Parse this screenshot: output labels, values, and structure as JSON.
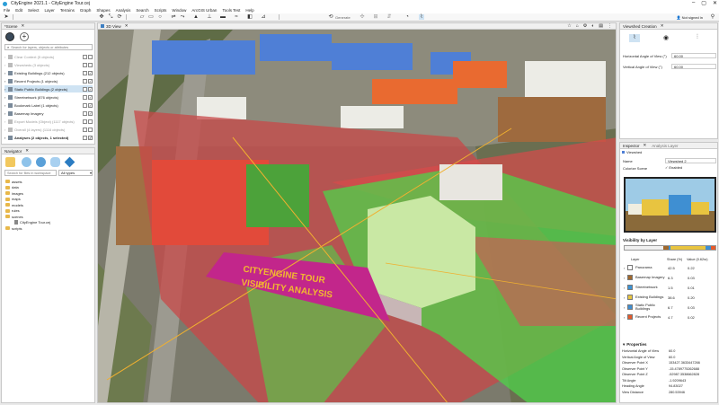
{
  "app": {
    "title": "CityEngine 2021.1 - CityEngine Tour.cej",
    "signin": "Not signed in"
  },
  "menu": [
    "File",
    "Edit",
    "Select",
    "Layer",
    "Terrains",
    "Graph",
    "Shapes",
    "Analysis",
    "Search",
    "Scripts",
    "Window",
    "ArcGIS Urban",
    "Tools Test",
    "Help"
  ],
  "toolbar": {
    "generate": "Generate"
  },
  "scene": {
    "tab": "*Scene",
    "search_placeholder": "Search for layers, objects or attributes",
    "layers": [
      {
        "name": "Clear Context (5 objects)",
        "faded": true
      },
      {
        "name": "Viewsheds (3 objects)",
        "faded": true
      },
      {
        "name": "Existing Buildings (212 objects)",
        "faded": false
      },
      {
        "name": "Recent Projects (1 objects)",
        "faded": false
      },
      {
        "name": "Static Public Buildings (2 objects)",
        "faded": false,
        "selected": true
      },
      {
        "name": "Streetnetwork (876 objects)",
        "faded": false
      },
      {
        "name": "Bookmark Label (1 objects)",
        "faded": false
      },
      {
        "name": "Basemap Imagery",
        "faded": false
      },
      {
        "name": "Export Models (Object) (1117 objects)",
        "faded": true
      },
      {
        "name": "Overall (4 layers) (1116 objects)",
        "faded": true
      },
      {
        "name": "Analyses (2 objects, 1 selected)",
        "faded": false,
        "bold": true
      }
    ]
  },
  "navigator": {
    "tab": "Navigator",
    "search_placeholder": "Search for files in workspace",
    "filter": "All types",
    "tree": [
      "assets",
      "data",
      "images",
      "maps",
      "models",
      "rules",
      "scenes",
      "CityEngine Tour.cej",
      "scripts"
    ]
  },
  "view3d": {
    "tab": "3D View",
    "banner_line1": "CITYENGINE TOUR",
    "banner_line2": "VISIBILITY ANALYSIS"
  },
  "viewshed": {
    "tab": "Viewshed Creation",
    "h_label": "Horizontal Angle of View (°)",
    "h_value": "60.00",
    "v_label": "Vertical Angle of View (°)",
    "v_value": "60.00"
  },
  "inspector": {
    "tab1": "Inspector",
    "tab2": "Analysis Layer",
    "subtab": "Viewshed",
    "name_label": "Name",
    "name_value": "Viewshed 2",
    "colorize_label": "Colorize Scene",
    "colorize_value": "Enabled",
    "vis_title": "Visibility by Layer",
    "cols": [
      "Layer",
      "Share (%)",
      "Value (0.62sr)"
    ],
    "rows": [
      {
        "name": "Panorama",
        "share": "42.5",
        "value": "0.22",
        "color": "#ffffff"
      },
      {
        "name": "Basemap Imagery",
        "share": "6.3",
        "value": "0.03",
        "color": "#a0682c"
      },
      {
        "name": "Streetnetwork",
        "share": "1.5",
        "value": "0.01",
        "color": "#3b93d6"
      },
      {
        "name": "Existing Buildings",
        "share": "38.6",
        "value": "0.20",
        "color": "#e8c440"
      },
      {
        "name": "Static Public Buildings",
        "share": "6.7",
        "value": "0.03",
        "color": "#3f8fd2"
      },
      {
        "name": "Recent Projects",
        "share": "4.7",
        "value": "0.02",
        "color": "#e55a2a"
      }
    ],
    "bar_colors": [
      "#f0f0f0",
      "#a0682c",
      "#3b93d6",
      "#e8c440",
      "#3f8fd2",
      "#e55a2a"
    ]
  },
  "properties": {
    "title": "Properties",
    "rows": [
      [
        "Horizontal Angle of View",
        "60.0"
      ],
      [
        "Vertical Angle of View",
        "60.0"
      ],
      [
        "Observer Point X",
        "153427.3633447266"
      ],
      [
        "Observer Point Y",
        "-15.4789775262688"
      ],
      [
        "Observer Point Z",
        "-52987.3538662828"
      ],
      [
        "Tilt Angle",
        "-1.9209643"
      ],
      [
        "Heading Angle",
        "94.83027"
      ],
      [
        "View Distance",
        "280.53946"
      ]
    ]
  }
}
